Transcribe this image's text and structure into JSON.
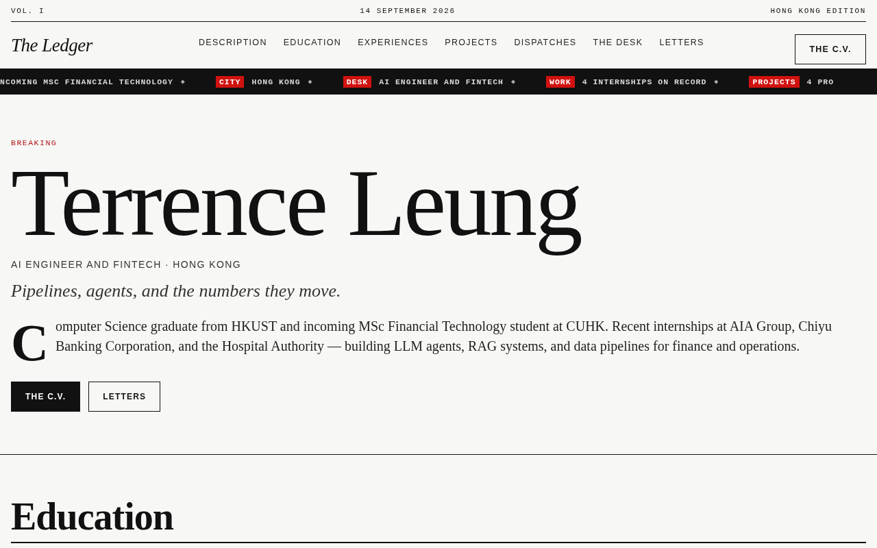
{
  "masthead": {
    "volume": "VOL. I",
    "date": "14 SEPTEMBER 2026",
    "edition": "HONG KONG EDITION"
  },
  "nav": {
    "logo": "The Ledger",
    "links": [
      "DESCRIPTION",
      "EDUCATION",
      "EXPERIENCES",
      "PROJECTS",
      "DISPATCHES",
      "THE DESK",
      "LETTERS"
    ],
    "cta": "THE C.V."
  },
  "ticker": [
    {
      "text": "NCOMING MSC FINANCIAL TECHNOLOGY",
      "separator": "◆"
    },
    {
      "tag": "CITY",
      "text": "HONG KONG",
      "separator": "◆"
    },
    {
      "tag": "DESK",
      "text": "AI ENGINEER AND FINTECH",
      "separator": "◆"
    },
    {
      "tag": "WORK",
      "text": "4 INTERNSHIPS ON RECORD",
      "separator": "◆"
    },
    {
      "tag": "PROJECTS",
      "text": "4 PRO"
    }
  ],
  "hero": {
    "kicker": "BREAKING",
    "name": "Terrence Leung",
    "role": "AI ENGINEER AND FINTECH · HONG KONG",
    "tagline": "Pipelines, agents, and the numbers they move.",
    "dropcap": "C",
    "lede": "omputer Science graduate from HKUST and incoming MSc Financial Technology student at CUHK. Recent internships at AIA Group, Chiyu Banking Corporation, and the Hospital Authority — building LLM agents, RAG systems, and data pipelines for finance and operations.",
    "buttons": [
      {
        "label": "THE C.V.",
        "kind": "primary"
      },
      {
        "label": "LETTERS",
        "kind": "outline"
      }
    ]
  },
  "section": {
    "title": "Education"
  }
}
